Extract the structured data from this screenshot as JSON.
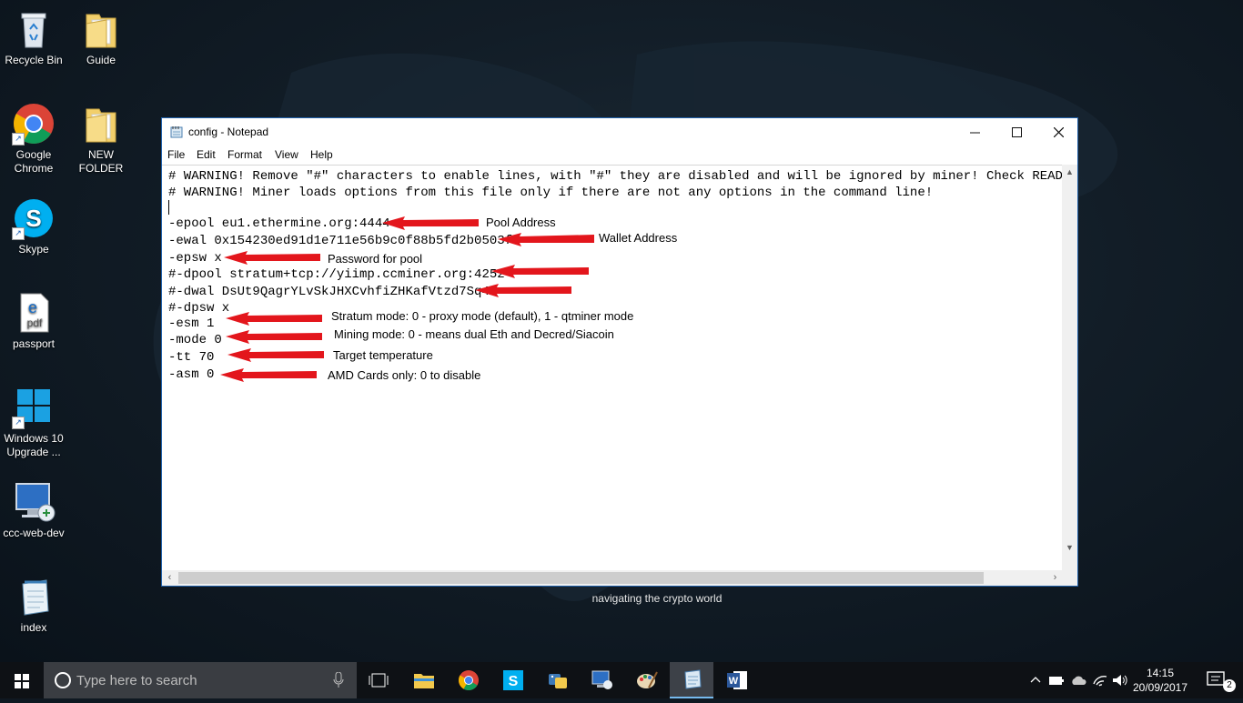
{
  "desktop": {
    "icons": [
      {
        "label": "Recycle Bin"
      },
      {
        "label": "Guide"
      },
      {
        "label": "Google Chrome"
      },
      {
        "label": "NEW FOLDER"
      },
      {
        "label": "Skype"
      },
      {
        "label": "passport"
      },
      {
        "label": "Windows 10 Upgrade ..."
      },
      {
        "label": "ccc-web-dev"
      },
      {
        "label": "index"
      }
    ],
    "tagline": "navigating the crypto world"
  },
  "notepad": {
    "title": "config - Notepad",
    "menu": [
      "File",
      "Edit",
      "Format",
      "View",
      "Help"
    ],
    "lines": [
      "# WARNING! Remove \"#\" characters to enable lines, with \"#\" they are disabled and will be ignored by miner! Check README for",
      "# WARNING! Miner loads options from this file only if there are not any options in the command line!",
      "",
      "-epool eu1.ethermine.org:4444",
      "-ewal 0x154230ed91d1e711e56b9c0f88b5fd2b0503f",
      "-epsw x",
      "#-dpool stratum+tcp://yiimp.ccminer.org:4252",
      "#-dwal DsUt9QagrYLvSkJHXCvhfiZHKafVtzd7Sq4",
      "#-dpsw x",
      "-esm 1",
      "-mode 0",
      "-tt 70",
      "-asm 0"
    ]
  },
  "annotations": [
    "Pool Address",
    "Wallet Address",
    "Password for pool",
    "Stratum mode: 0 - proxy mode (default), 1 - qtminer mode",
    "Mining mode: 0 - means dual Eth and Decred/Siacoin",
    "Target temperature",
    "AMD Cards only: 0 to disable"
  ],
  "taskbar": {
    "search_placeholder": "Type here to search",
    "time": "14:15",
    "date": "20/09/2017",
    "notification_count": "2"
  },
  "colors": {
    "arrow": "#e3161c",
    "accent": "#1f5fa8"
  }
}
